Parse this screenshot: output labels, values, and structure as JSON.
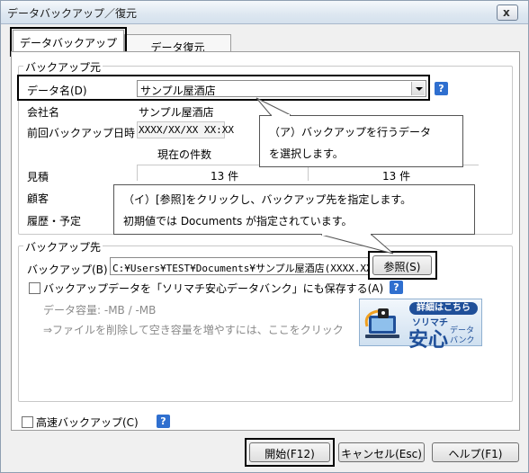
{
  "window": {
    "title": "データバックアップ／復元",
    "close_glyph": "x"
  },
  "tabs": [
    {
      "label": "データバックアップ",
      "active": true
    },
    {
      "label": "データ復元",
      "active": false
    }
  ],
  "source": {
    "group_title": "バックアップ元",
    "data_name_label": "データ名(D)",
    "data_name_value": "サンプル屋酒店",
    "company_label": "会社名",
    "company_value": "サンプル屋酒店",
    "last_backup_label": "前回バックアップ日時",
    "last_backup_value": "XXXX/XX/XX XX:XX",
    "count_header": "現在の件数",
    "rows": [
      {
        "label": "見積",
        "value1": "13 件",
        "value2": "13 件"
      },
      {
        "label": "顧客"
      },
      {
        "label": "履歴・予定"
      }
    ]
  },
  "destination": {
    "group_title": "バックアップ先",
    "path_label": "バックアップ(B)",
    "path_value": "C:¥Users¥TEST¥Documents¥サンプル屋酒店(XXXX.XX.",
    "browse_button": "参照(S)",
    "bank_checkbox_label": "バックアップデータを「ソリマチ安心データバンク」にも保存する(A)",
    "capacity_text": "データ容量: -MB / -MB",
    "hint_text": "⇒ファイルを削除して空き容量を増やすには、ここをクリック",
    "banner": {
      "tag": "詳細はこちら",
      "brand": "ソリマチ",
      "big": "安心",
      "small_line1": "データ",
      "small_line2": "バンク"
    }
  },
  "fast_backup_label": "高速バックアップ(C)",
  "help_glyph": "?",
  "buttons": {
    "start": "開始(F12)",
    "cancel": "キャンセル(Esc)",
    "help": "ヘルプ(F1)"
  },
  "callouts": {
    "a_line1": "（ア）バックアップを行うデータ",
    "a_line2": "を選択します。",
    "b_line1": "（イ）[参照]をクリックし、バックアップ先を指定します。",
    "b_line2": "初期値では Documents が指定されています。"
  }
}
